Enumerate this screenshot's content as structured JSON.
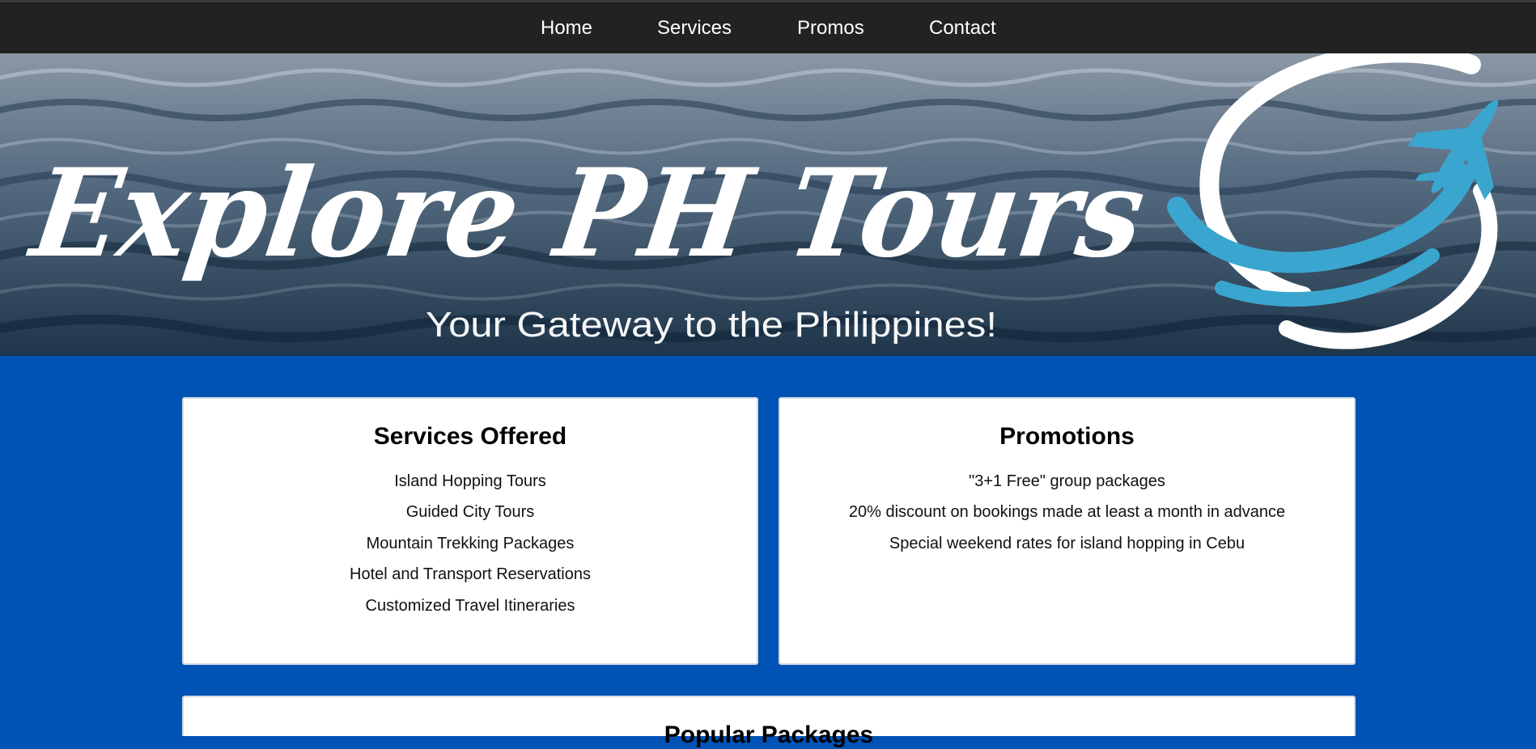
{
  "nav": {
    "items": [
      {
        "label": "Home"
      },
      {
        "label": "Services"
      },
      {
        "label": "Promos"
      },
      {
        "label": "Contact"
      }
    ]
  },
  "banner": {
    "brand": "Explore PH Tours",
    "tagline": "Your Gateway to the Philippines!",
    "icons": [
      "globe-swoosh-logo",
      "airplane-icon"
    ]
  },
  "services": {
    "title": "Services Offered",
    "items": [
      "Island Hopping Tours",
      "Guided City Tours",
      "Mountain Trekking Packages",
      "Hotel and Transport Reservations",
      "Customized Travel Itineraries"
    ]
  },
  "promotions": {
    "title": "Promotions",
    "items": [
      "\"3+1 Free\" group packages",
      "20% discount on bookings made at least a month in advance",
      "Special weekend rates for island hopping in Cebu"
    ]
  },
  "packages": {
    "title": "Popular Packages"
  },
  "colors": {
    "page_background": "#0052b4",
    "navbar_background": "#222222",
    "logo_accent": "#3aa6d0",
    "card_background": "#ffffff"
  }
}
